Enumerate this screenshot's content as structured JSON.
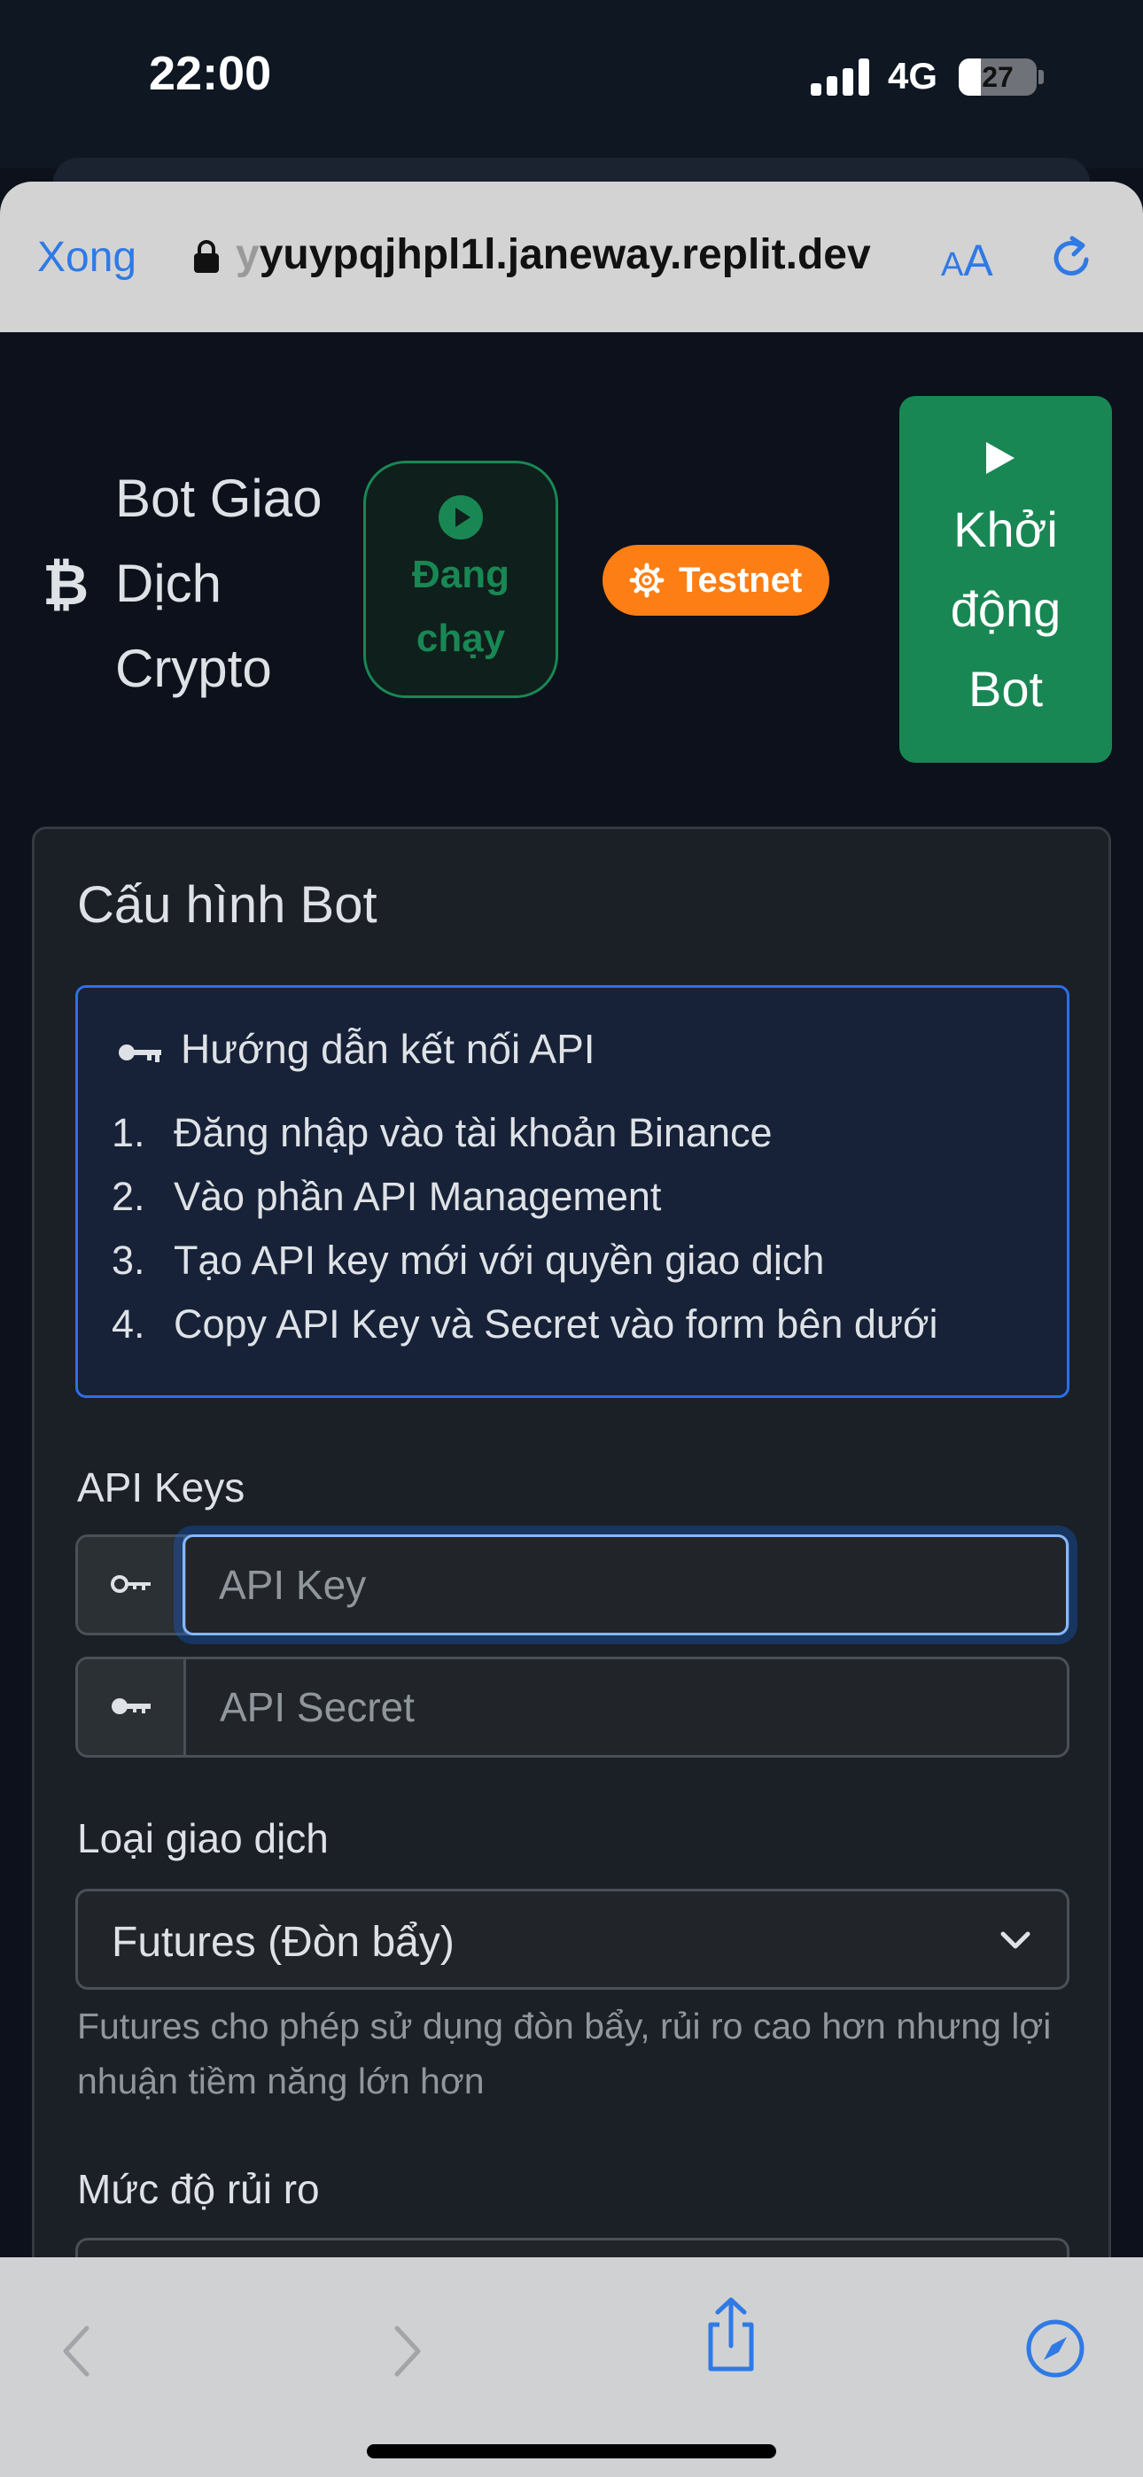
{
  "status_bar": {
    "time": "22:00",
    "network": "4G",
    "battery": "27"
  },
  "browser": {
    "done_label": "Xong",
    "url_faded": "y",
    "url": "yuypqjhpl1l.janeway.replit.dev",
    "text_size_label_small": "A",
    "text_size_label_large": "A"
  },
  "header": {
    "brand_icon": "bitcoin-icon",
    "brand_title": "Bot Giao Dịch Crypto",
    "status_badge": "Đang chạy",
    "network_badge": "Testnet",
    "start_button": "Khởi động Bot"
  },
  "config": {
    "title": "Cấu hình Bot",
    "guide": {
      "title": "Hướng dẫn kết nối API",
      "steps": [
        {
          "num": "1.",
          "text": "Đăng nhập vào tài khoản Binance"
        },
        {
          "num": "2.",
          "text": "Vào phần API Management"
        },
        {
          "num": "3.",
          "text": "Tạo API key mới với quyền giao dịch"
        },
        {
          "num": "4.",
          "text": "Copy API Key và Secret vào form bên dưới"
        }
      ]
    },
    "api_keys_label": "API Keys",
    "api_key_placeholder": "API Key",
    "api_secret_placeholder": "API Secret",
    "trade_type_label": "Loại giao dịch",
    "trade_type_value": "Futures (Đòn bẩy)",
    "trade_type_help": "Futures cho phép sử dụng đòn bẩy, rủi ro cao hơn nhưng lợi nhuận tiềm năng lớn hơn",
    "risk_label": "Mức độ rủi ro"
  },
  "colors": {
    "success": "#198754",
    "warning": "#fd7e14",
    "primary": "#2f6ee6",
    "safari_blue": "#2f7ae5"
  }
}
